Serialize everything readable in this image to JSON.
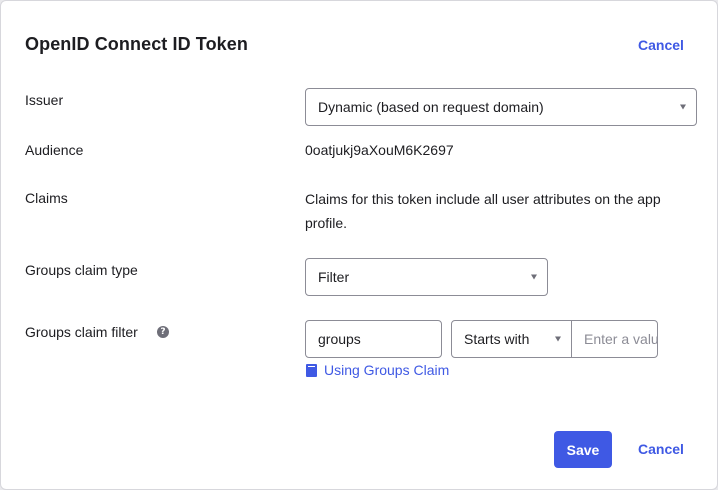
{
  "dialog": {
    "title": "OpenID Connect ID Token",
    "cancel_top": "Cancel"
  },
  "issuer": {
    "label": "Issuer",
    "selected": "Dynamic (based on request domain)"
  },
  "audience": {
    "label": "Audience",
    "value": "0oatjukj9aXouM6K2697"
  },
  "claims": {
    "label": "Claims",
    "text": "Claims for this token include all user attributes on the app profile."
  },
  "groups_claim_type": {
    "label": "Groups claim type",
    "selected": "Filter"
  },
  "groups_claim_filter": {
    "label": "Groups claim filter",
    "help_icon_text": "?",
    "name_value": "groups",
    "operator_selected": "Starts with",
    "value_placeholder": "Enter a value",
    "help_link": "Using Groups Claim"
  },
  "footer": {
    "save_label": "Save",
    "cancel_label": "Cancel"
  },
  "colors": {
    "accent": "#3f59e4",
    "border": "#8c8c96"
  },
  "icons": [
    "caret-down-icon",
    "help-icon",
    "book-icon"
  ]
}
